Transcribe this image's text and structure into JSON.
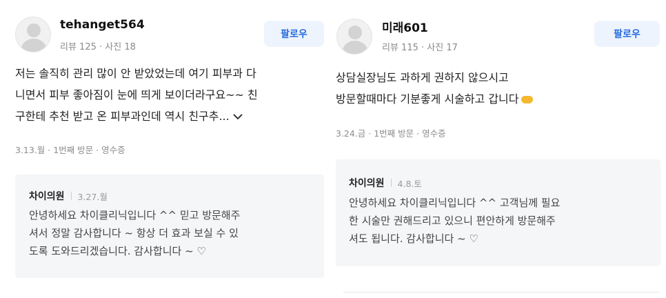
{
  "reviews": [
    {
      "username": "tehanget564",
      "meta": "리뷰 125 · 사진 18",
      "follow_label": "팔로우",
      "text_lines": [
        "저는 솔직히 관리 많이 안 받았었는데 여기 피부과 다",
        "니면서 피부 좋아짐이 눈에 띄게 보이더라구요~~ 친",
        "구한테 추천 받고 온 피부과인데 역시 친구추..."
      ],
      "expand_icon": "chevron-down-icon",
      "visit_info": "3.13.월 · 1번째 방문 · 영수증",
      "reply": {
        "name": "차이의원",
        "date": "3.27.월",
        "lines": [
          "안녕하세요 차이클리닉입니다 ^^ 믿고 방문해주",
          "셔서 정말 감사합니다 ~ 항상 더 효과 보실 수 있",
          "도록 도와드리겠습니다. 감사합니다 ~ ♡"
        ]
      }
    },
    {
      "username": "미래601",
      "meta": "리뷰 115 · 사진 17",
      "follow_label": "팔로우",
      "text_lines": [
        "상담실장님도 과하게 권하지 않으시고",
        "방문할때마다 기분좋게 시술하고 갑니다"
      ],
      "emoji_icon": "handshake-emoji-icon",
      "visit_info": "3.24.금 · 1번째 방문 · 영수증",
      "reply": {
        "name": "차이의원",
        "date": "4.8.토",
        "lines": [
          "안녕하세요 차이클리닉입니다 ^^ 고객님께 필요",
          "한 시술만 권해드리고 있으니 편안하게 방문해주",
          "셔도 됩니다. 감사합니다 ~ ♡"
        ]
      }
    }
  ],
  "colors": {
    "follow_text": "#2a6de0",
    "follow_bg": "#eef4fd",
    "reply_bg": "#f4f6f8",
    "meta_text": "#8a8a8a"
  }
}
